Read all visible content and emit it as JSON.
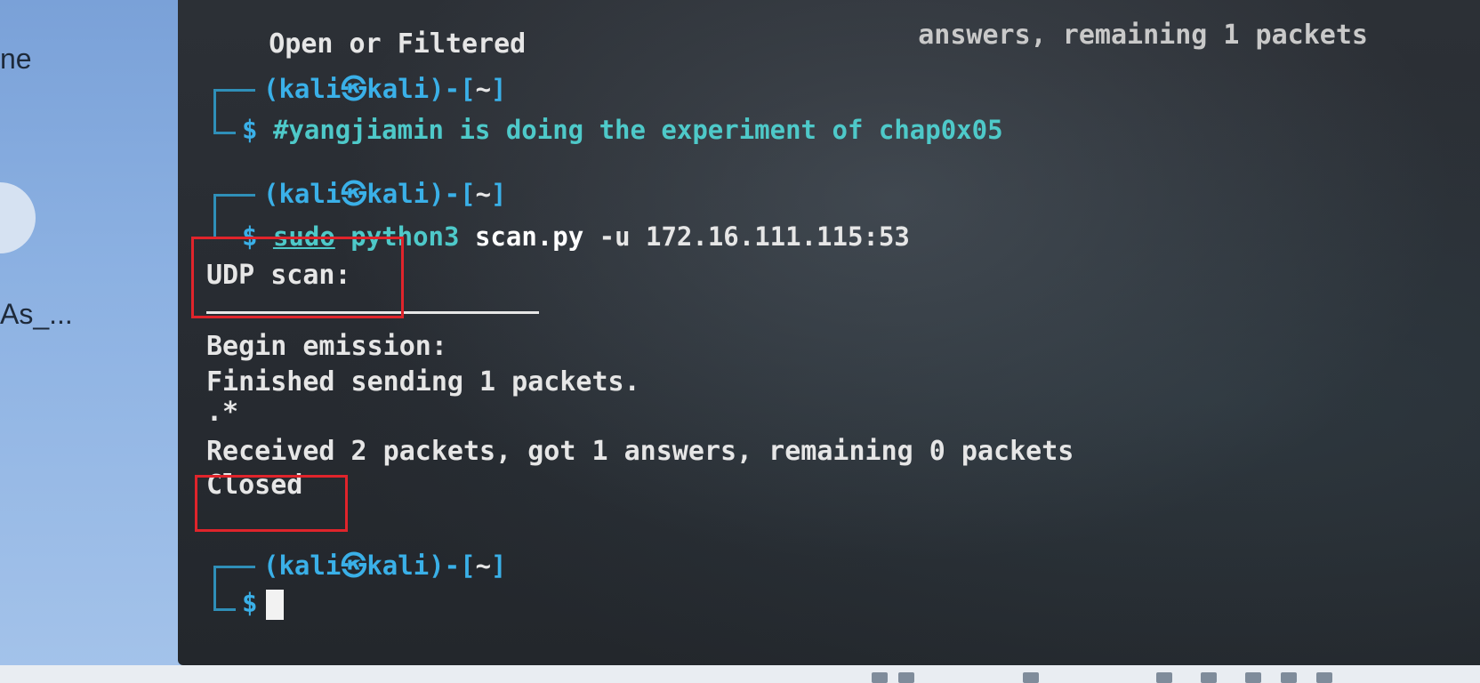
{
  "desktop": {
    "label_1": "ne",
    "label_2": "As_..."
  },
  "terminal": {
    "top_partial_line": "Open or Filtered",
    "top_partial_right": "answers, remaining 1 packets",
    "prompt": {
      "user": "kali",
      "host": "kali",
      "dir": "~",
      "at_symbol": "㉿",
      "dollar": "$"
    },
    "comment_command": "#yangjiamin is doing the experiment of chap0x05",
    "scan_command": {
      "sudo": "sudo",
      "python": "python3",
      "file": "scan.py",
      "args": "-u 172.16.111.115:53"
    },
    "output": {
      "udp_scan": "UDP scan:",
      "begin": "Begin emission:",
      "finished": "Finished sending 1 packets.",
      "dots": ".*",
      "received": "Received 2 packets, got 1 answers, remaining 0 packets",
      "result": "Closed"
    }
  },
  "colors": {
    "prompt": "#3ab0e8",
    "command": "#4ec9c9",
    "highlight": "#e0242b",
    "text": "#e6e6e6"
  }
}
